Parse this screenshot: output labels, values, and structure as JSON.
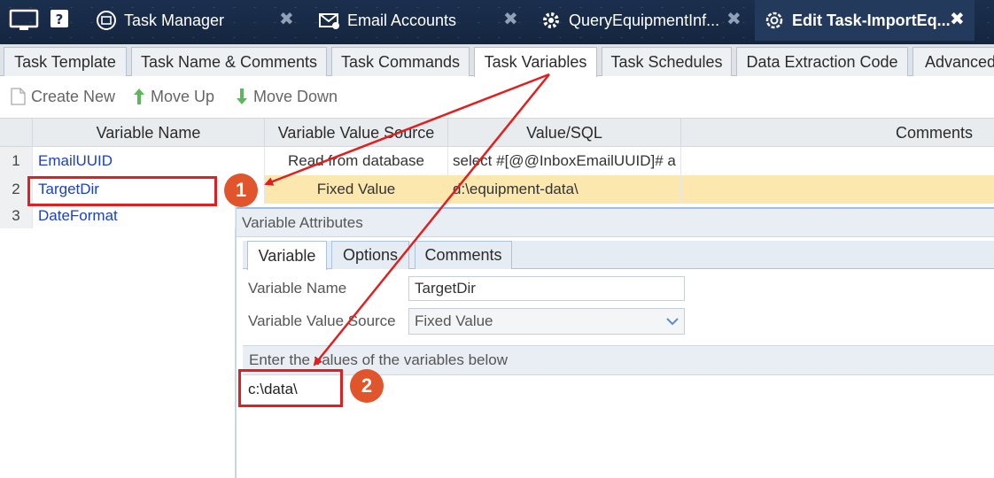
{
  "window_tabs": [
    {
      "label": "Task Manager",
      "icon": "task-manager-icon",
      "active": false
    },
    {
      "label": "Email Accounts",
      "icon": "email-accounts-icon",
      "active": false
    },
    {
      "label": "QueryEquipmentInf...",
      "icon": "gear-icon",
      "active": false
    },
    {
      "label": "Edit Task-ImportEq...",
      "icon": "gear-outline-icon",
      "active": true
    }
  ],
  "close_glyph": "✖",
  "property_tabs": [
    "Task Template",
    "Task Name & Comments",
    "Task Commands",
    "Task Variables",
    "Task Schedules",
    "Data Extraction Code",
    "Advanced"
  ],
  "active_property_tab": "Task Variables",
  "toolbar": {
    "create_new": "Create New",
    "move_up": "Move Up",
    "move_down": "Move Down"
  },
  "grid": {
    "columns": {
      "name": "Variable Name",
      "source": "Variable Value Source",
      "value": "Value/SQL",
      "comments": "Comments"
    },
    "rows": [
      {
        "num": "1",
        "name": "EmailUUID",
        "source": "Read from database",
        "value": "select #[@@InboxEmailUUID]# a",
        "comments": ""
      },
      {
        "num": "2",
        "name": "TargetDir",
        "source": "Fixed Value",
        "value": "d:\\equipment-data\\",
        "comments": ""
      },
      {
        "num": "3",
        "name": "DateFormat",
        "source": "",
        "value": "",
        "comments": ""
      }
    ],
    "selected_row": 2
  },
  "attributes": {
    "title": "Variable Attributes",
    "tabs": [
      "Variable",
      "Options",
      "Comments"
    ],
    "active_tab": "Variable",
    "name_label": "Variable Name",
    "name_value": "TargetDir",
    "source_label": "Variable Value Source",
    "source_value": "Fixed Value",
    "values_heading": "Enter the values of the variables below",
    "values_text": "c:\\data\\"
  },
  "annotations": {
    "badge1": "1",
    "badge2": "2"
  },
  "colors": {
    "accent": "#e02020",
    "badge": "#e0552b",
    "selected_row": "#fce8ae",
    "link": "#1a3fd1"
  }
}
